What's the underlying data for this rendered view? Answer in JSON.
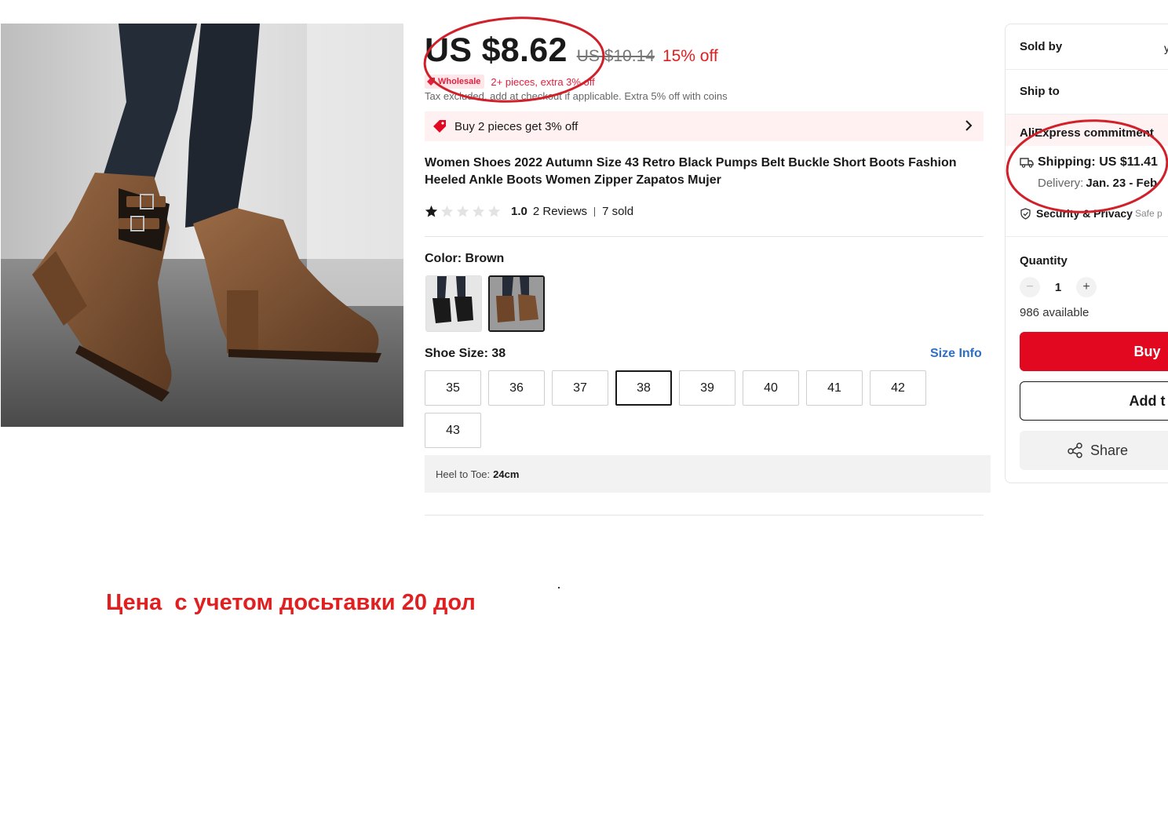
{
  "price": {
    "current": "US $8.62",
    "original": "US $10.14",
    "discount": "15% off",
    "wholesale_badge": "Wholesale",
    "wholesale_text": "2+ pieces, extra 3% off",
    "tax_note": "Tax excluded, add at checkout if applicable. Extra 5% off with coins"
  },
  "promo": {
    "text": "Buy 2 pieces get 3% off",
    "icon": "price-tag-icon"
  },
  "product": {
    "title": "Women Shoes 2022 Autumn Size 43 Retro Black Pumps Belt Buckle Short Boots Fashion Heeled Ankle Boots Women Zipper Zapatos Mujer",
    "rating_value": 1.0,
    "rating_text": "1.0",
    "reviews": "2 Reviews",
    "sold": "7 sold"
  },
  "color": {
    "label": "Color: Brown",
    "options": [
      "Black",
      "Brown"
    ],
    "selected_index": 1
  },
  "size": {
    "label": "Shoe Size: 38",
    "info_link": "Size Info",
    "options": [
      "35",
      "36",
      "37",
      "38",
      "39",
      "40",
      "41",
      "42",
      "43"
    ],
    "selected": "38",
    "note_label": "Heel to Toe:",
    "note_value": "24cm"
  },
  "panel": {
    "sold_by": "Sold by",
    "ship_to": "Ship to",
    "commitment": "AliExpress commitment",
    "shipping": "Shipping: US $11.41",
    "delivery_label": "Delivery:",
    "delivery_date": "Jan. 23 - Feb",
    "security_title": "Security & Privacy",
    "security_sub": "Safe p",
    "quantity_label": "Quantity",
    "quantity": "1",
    "minus": "−",
    "plus": "+",
    "available": "986 available",
    "buy": "Buy",
    "add_to_cart": "Add t",
    "share": "Share"
  },
  "annotation": {
    "note": "Цена  с учетом досьтавки 20 дол",
    "color": "#e02020"
  },
  "colors": {
    "accent_red": "#e1081f",
    "link_blue": "#2d6ec8",
    "promo_bg": "#fff0f1"
  }
}
